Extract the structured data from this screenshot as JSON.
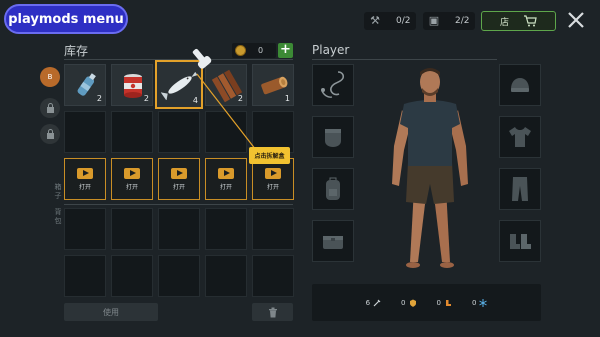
{
  "mod_menu": {
    "label": "playmods menu"
  },
  "top_bar": {
    "resource1": {
      "icon": "tools-icon",
      "value": "0/2"
    },
    "resource2": {
      "icon": "crate-icon",
      "value": "2/2"
    },
    "shop": {
      "label": "店",
      "icon": "cart-icon"
    },
    "close_icon": "close-icon"
  },
  "inventory": {
    "title": "库存",
    "coins": "0",
    "plus_label": "+",
    "tabs": [
      {
        "label": "B",
        "state": "active"
      },
      {
        "label": "",
        "state": "locked"
      },
      {
        "label": "",
        "state": "locked"
      }
    ],
    "side_label_chest": "箱子",
    "side_label_bag": "背包",
    "row1": [
      {
        "item": "water-bottle-icon",
        "qty": "2"
      },
      {
        "item": "canned-food-icon",
        "qty": "2"
      },
      {
        "item": "fish-icon",
        "qty": "4"
      },
      {
        "item": "wood-planks-icon",
        "qty": "2"
      },
      {
        "item": "log-icon",
        "qty": "1"
      }
    ],
    "chest_slots": [
      "打开",
      "打开",
      "打开",
      "打开",
      "打开"
    ],
    "tooltip": "点击拆解盒",
    "use_label": "使用"
  },
  "player": {
    "title": "Player",
    "stats": [
      {
        "icon": "sword-icon",
        "value": "6"
      },
      {
        "icon": "shield-icon",
        "value": "0"
      },
      {
        "icon": "boot-icon",
        "value": "0"
      },
      {
        "icon": "snowflake-icon",
        "value": "0"
      }
    ]
  },
  "colors": {
    "accent": "#e3a12a",
    "shop_border": "#5ea64b",
    "menu_blue": "#2e2fc4"
  }
}
